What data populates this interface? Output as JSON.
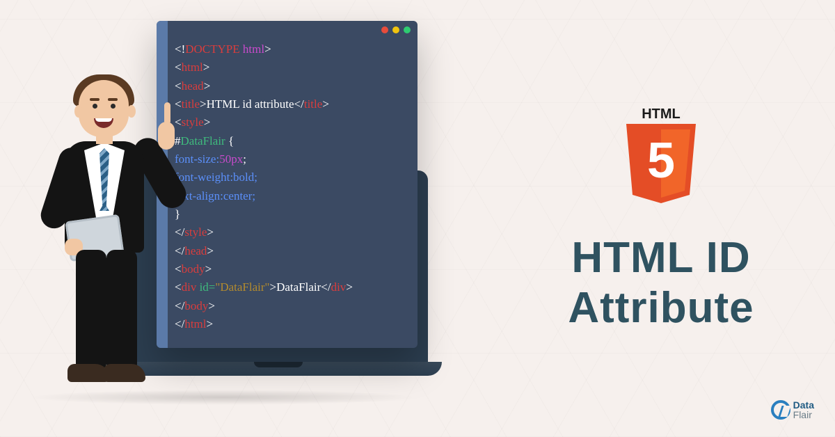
{
  "badge": {
    "label": "HTML",
    "number": "5"
  },
  "headline": {
    "line1": "HTML ID",
    "line2": "Attribute"
  },
  "logo": {
    "line1": "Data",
    "line2": "Flair"
  },
  "code": {
    "l1a": "<!",
    "l1b": "DOCTYPE ",
    "l1c": "html",
    "l1d": ">",
    "l2a": "<",
    "l2b": "html",
    "l2c": ">",
    "l3a": "<",
    "l3b": "head",
    "l3c": ">",
    "l4a": "<",
    "l4b": "title",
    "l4c": ">",
    "l4d": "HTML id attribute",
    "l4e": "</",
    "l4f": "title",
    "l4g": ">",
    "l5a": "<",
    "l5b": "style",
    "l5c": ">",
    "l6a": "#",
    "l6b": "DataFlair ",
    "l6c": "{",
    "l7a": "font-size:",
    "l7b": "50px",
    "l7c": ";",
    "l8": "font-weight:bold;",
    "l9": "text-align:center;",
    "l10": "}",
    "l11a": "</",
    "l11b": "style",
    "l11c": ">",
    "l12a": "</",
    "l12b": "head",
    "l12c": ">",
    "l13a": "<",
    "l13b": "body",
    "l13c": ">",
    "l14a": "<",
    "l14b": "div ",
    "l14c": "id=",
    "l14d": "\"DataFlair\"",
    "l14e": ">",
    "l14f": "DataFlair",
    "l14g": "</",
    "l14h": "div",
    "l14i": ">",
    "l15a": "</",
    "l15b": "body",
    "l15c": ">",
    "l16a": "</",
    "l16b": "html",
    "l16c": ">"
  }
}
